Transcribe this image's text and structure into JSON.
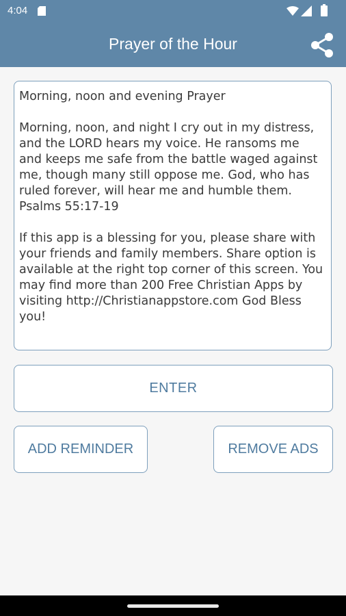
{
  "status_bar": {
    "time": "4:04",
    "icons": [
      "sd-card-icon",
      "wifi-icon",
      "signal-icon",
      "battery-icon"
    ]
  },
  "app_bar": {
    "title": "Prayer of the Hour",
    "share_icon": "share-icon",
    "background_color": "#5f87a8"
  },
  "prayer": {
    "text": "Morning, noon and evening Prayer\n\nMorning, noon, and night I cry out in my distress, and the LORD hears my voice. He ransoms me and keeps me safe from the battle waged against me, though many still oppose me. God, who has ruled forever, will hear me and humble them. Psalms 55:17-19\n\nIf this app is a blessing for you, please share with your friends and family members. Share option is available at the right top corner of this screen. You may find more than 200 Free Christian Apps by visiting http://Christianappstore.com God Bless you!"
  },
  "buttons": {
    "enter": "ENTER",
    "add_reminder": "ADD REMINDER",
    "remove_ads": "REMOVE ADS"
  },
  "colors": {
    "accent": "#5f87a8",
    "button_text": "#4f7b9f",
    "border": "#7d9fbc"
  }
}
